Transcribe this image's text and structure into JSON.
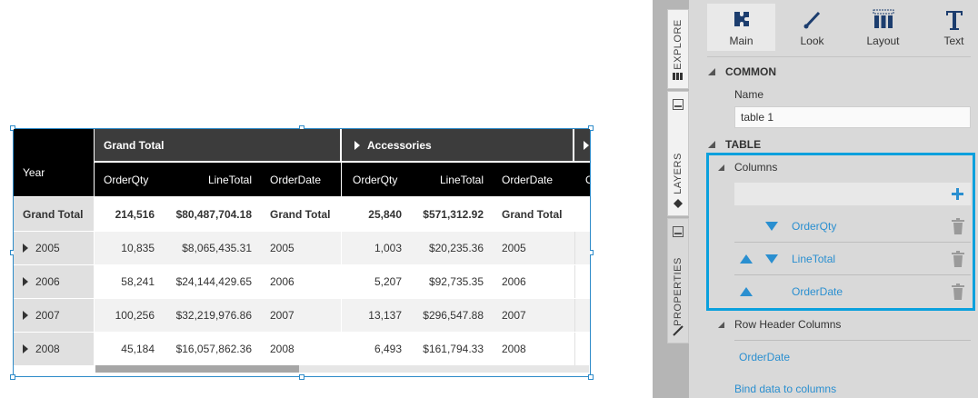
{
  "table": {
    "group_headers": [
      "Grand Total",
      "Accessories"
    ],
    "year_label": "Year",
    "column_headers": [
      "OrderQty",
      "LineTotal",
      "OrderDate",
      "OrderQty",
      "LineTotal",
      "OrderDate",
      "O"
    ],
    "grand_total_row": {
      "label": "Grand Total",
      "values": [
        "214,516",
        "$80,487,704.18",
        "Grand Total",
        "25,840",
        "$571,312.92",
        "Grand Total"
      ]
    },
    "rows": [
      {
        "year": "2005",
        "values": [
          "10,835",
          "$8,065,435.31",
          "2005",
          "1,003",
          "$20,235.36",
          "2005"
        ]
      },
      {
        "year": "2006",
        "values": [
          "58,241",
          "$24,144,429.65",
          "2006",
          "5,207",
          "$92,735.35",
          "2006"
        ]
      },
      {
        "year": "2007",
        "values": [
          "100,256",
          "$32,219,976.86",
          "2007",
          "13,137",
          "$296,547.88",
          "2007"
        ]
      },
      {
        "year": "2008",
        "values": [
          "45,184",
          "$16,057,862.36",
          "2008",
          "6,493",
          "$161,794.33",
          "2008"
        ]
      }
    ]
  },
  "side_tabs": {
    "explore": "EXPLORE",
    "layers": "LAYERS",
    "properties": "PROPERTIES"
  },
  "toolbar": {
    "main": "Main",
    "look": "Look",
    "layout": "Layout",
    "text": "Text"
  },
  "panel": {
    "common_title": "COMMON",
    "name_label": "Name",
    "name_value": "table 1",
    "table_title": "TABLE",
    "columns_label": "Columns",
    "columns": [
      "OrderQty",
      "LineTotal",
      "OrderDate"
    ],
    "row_header_label": "Row Header Columns",
    "row_header_value": "OrderDate",
    "bind_link": "Bind data to columns"
  },
  "colors": {
    "accent": "#2a8fd0",
    "highlight_box": "#0aa0dd",
    "header_dark": "#3c3c3c",
    "header_black": "#000000"
  }
}
